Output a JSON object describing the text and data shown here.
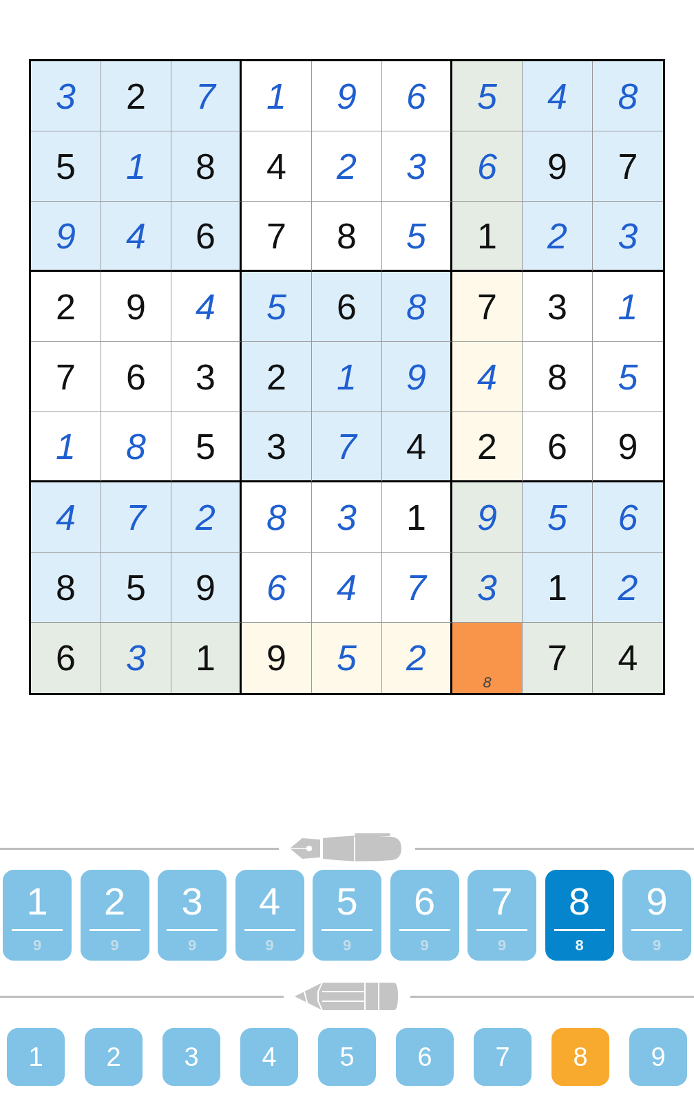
{
  "grid": [
    [
      {
        "value": "3",
        "kind": "entered",
        "color": "#ddeefb"
      },
      {
        "value": "2",
        "kind": "given",
        "color": "#ddeefb"
      },
      {
        "value": "7",
        "kind": "entered",
        "color": "#ddeefb"
      },
      {
        "value": "1",
        "kind": "entered",
        "color": "#ffffff"
      },
      {
        "value": "9",
        "kind": "entered",
        "color": "#ffffff"
      },
      {
        "value": "6",
        "kind": "entered",
        "color": "#ffffff"
      },
      {
        "value": "5",
        "kind": "entered",
        "color": "#e5ece4"
      },
      {
        "value": "4",
        "kind": "entered",
        "color": "#ddeefb"
      },
      {
        "value": "8",
        "kind": "entered",
        "color": "#ddeefb"
      }
    ],
    [
      {
        "value": "5",
        "kind": "given",
        "color": "#ddeefb"
      },
      {
        "value": "1",
        "kind": "entered",
        "color": "#ddeefb"
      },
      {
        "value": "8",
        "kind": "given",
        "color": "#ddeefb"
      },
      {
        "value": "4",
        "kind": "given",
        "color": "#ffffff"
      },
      {
        "value": "2",
        "kind": "entered",
        "color": "#ffffff"
      },
      {
        "value": "3",
        "kind": "entered",
        "color": "#ffffff"
      },
      {
        "value": "6",
        "kind": "entered",
        "color": "#e5ece4"
      },
      {
        "value": "9",
        "kind": "given",
        "color": "#ddeefb"
      },
      {
        "value": "7",
        "kind": "given",
        "color": "#ddeefb"
      }
    ],
    [
      {
        "value": "9",
        "kind": "entered",
        "color": "#ddeefb"
      },
      {
        "value": "4",
        "kind": "entered",
        "color": "#ddeefb"
      },
      {
        "value": "6",
        "kind": "given",
        "color": "#ddeefb"
      },
      {
        "value": "7",
        "kind": "given",
        "color": "#ffffff"
      },
      {
        "value": "8",
        "kind": "given",
        "color": "#ffffff"
      },
      {
        "value": "5",
        "kind": "entered",
        "color": "#ffffff"
      },
      {
        "value": "1",
        "kind": "given",
        "color": "#e5ece4"
      },
      {
        "value": "2",
        "kind": "entered",
        "color": "#ddeefb"
      },
      {
        "value": "3",
        "kind": "entered",
        "color": "#ddeefb"
      }
    ],
    [
      {
        "value": "2",
        "kind": "given",
        "color": "#ffffff"
      },
      {
        "value": "9",
        "kind": "given",
        "color": "#ffffff"
      },
      {
        "value": "4",
        "kind": "entered",
        "color": "#ffffff"
      },
      {
        "value": "5",
        "kind": "entered",
        "color": "#ddeefb"
      },
      {
        "value": "6",
        "kind": "given",
        "color": "#ddeefb"
      },
      {
        "value": "8",
        "kind": "entered",
        "color": "#ddeefb"
      },
      {
        "value": "7",
        "kind": "given",
        "color": "#fef9e8"
      },
      {
        "value": "3",
        "kind": "given",
        "color": "#ffffff"
      },
      {
        "value": "1",
        "kind": "entered",
        "color": "#ffffff"
      }
    ],
    [
      {
        "value": "7",
        "kind": "given",
        "color": "#ffffff"
      },
      {
        "value": "6",
        "kind": "given",
        "color": "#ffffff"
      },
      {
        "value": "3",
        "kind": "given",
        "color": "#ffffff"
      },
      {
        "value": "2",
        "kind": "given",
        "color": "#ddeefb"
      },
      {
        "value": "1",
        "kind": "entered",
        "color": "#ddeefb"
      },
      {
        "value": "9",
        "kind": "entered",
        "color": "#ddeefb"
      },
      {
        "value": "4",
        "kind": "entered",
        "color": "#fef9e8"
      },
      {
        "value": "8",
        "kind": "given",
        "color": "#ffffff"
      },
      {
        "value": "5",
        "kind": "entered",
        "color": "#ffffff"
      }
    ],
    [
      {
        "value": "1",
        "kind": "entered",
        "color": "#ffffff"
      },
      {
        "value": "8",
        "kind": "entered",
        "color": "#ffffff"
      },
      {
        "value": "5",
        "kind": "given",
        "color": "#ffffff"
      },
      {
        "value": "3",
        "kind": "given",
        "color": "#ddeefb"
      },
      {
        "value": "7",
        "kind": "entered",
        "color": "#ddeefb"
      },
      {
        "value": "4",
        "kind": "given",
        "color": "#ddeefb"
      },
      {
        "value": "2",
        "kind": "given",
        "color": "#fef9e8"
      },
      {
        "value": "6",
        "kind": "given",
        "color": "#ffffff"
      },
      {
        "value": "9",
        "kind": "given",
        "color": "#ffffff"
      }
    ],
    [
      {
        "value": "4",
        "kind": "entered",
        "color": "#ddeefb"
      },
      {
        "value": "7",
        "kind": "entered",
        "color": "#ddeefb"
      },
      {
        "value": "2",
        "kind": "entered",
        "color": "#ddeefb"
      },
      {
        "value": "8",
        "kind": "entered",
        "color": "#ffffff"
      },
      {
        "value": "3",
        "kind": "entered",
        "color": "#ffffff"
      },
      {
        "value": "1",
        "kind": "given",
        "color": "#ffffff"
      },
      {
        "value": "9",
        "kind": "entered",
        "color": "#e5ece4"
      },
      {
        "value": "5",
        "kind": "entered",
        "color": "#ddeefb"
      },
      {
        "value": "6",
        "kind": "entered",
        "color": "#ddeefb"
      }
    ],
    [
      {
        "value": "8",
        "kind": "given",
        "color": "#ddeefb"
      },
      {
        "value": "5",
        "kind": "given",
        "color": "#ddeefb"
      },
      {
        "value": "9",
        "kind": "given",
        "color": "#ddeefb"
      },
      {
        "value": "6",
        "kind": "entered",
        "color": "#ffffff"
      },
      {
        "value": "4",
        "kind": "entered",
        "color": "#ffffff"
      },
      {
        "value": "7",
        "kind": "entered",
        "color": "#ffffff"
      },
      {
        "value": "3",
        "kind": "entered",
        "color": "#e5ece4"
      },
      {
        "value": "1",
        "kind": "given",
        "color": "#ddeefb"
      },
      {
        "value": "2",
        "kind": "entered",
        "color": "#ddeefb"
      }
    ],
    [
      {
        "value": "6",
        "kind": "given",
        "color": "#e5ece4"
      },
      {
        "value": "3",
        "kind": "entered",
        "color": "#e5ece4"
      },
      {
        "value": "1",
        "kind": "given",
        "color": "#e5ece4"
      },
      {
        "value": "9",
        "kind": "given",
        "color": "#fef9e8"
      },
      {
        "value": "5",
        "kind": "entered",
        "color": "#fef9e8"
      },
      {
        "value": "2",
        "kind": "entered",
        "color": "#fef9e8"
      },
      {
        "note": "8",
        "kind": "empty",
        "color": "#f8954a"
      },
      {
        "value": "7",
        "kind": "given",
        "color": "#e5ece4"
      },
      {
        "value": "4",
        "kind": "given",
        "color": "#e5ece4"
      }
    ]
  ],
  "pen_keys": [
    {
      "digit": "1",
      "count": "9",
      "selected": false
    },
    {
      "digit": "2",
      "count": "9",
      "selected": false
    },
    {
      "digit": "3",
      "count": "9",
      "selected": false
    },
    {
      "digit": "4",
      "count": "9",
      "selected": false
    },
    {
      "digit": "5",
      "count": "9",
      "selected": false
    },
    {
      "digit": "6",
      "count": "9",
      "selected": false
    },
    {
      "digit": "7",
      "count": "9",
      "selected": false
    },
    {
      "digit": "8",
      "count": "8",
      "selected": true
    },
    {
      "digit": "9",
      "count": "9",
      "selected": false
    }
  ],
  "pencil_keys": [
    {
      "digit": "1",
      "selected": false
    },
    {
      "digit": "2",
      "selected": false
    },
    {
      "digit": "3",
      "selected": false
    },
    {
      "digit": "4",
      "selected": false
    },
    {
      "digit": "5",
      "selected": false
    },
    {
      "digit": "6",
      "selected": false
    },
    {
      "digit": "7",
      "selected": false
    },
    {
      "digit": "8",
      "selected": true
    },
    {
      "digit": "9",
      "selected": false
    }
  ]
}
